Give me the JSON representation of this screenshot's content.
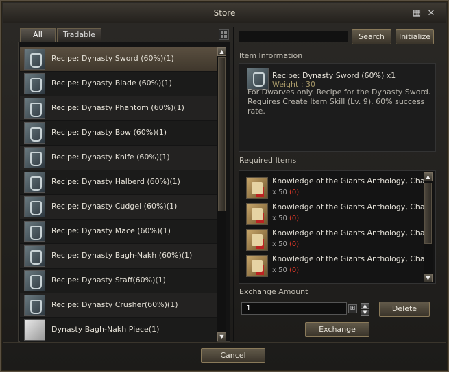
{
  "window": {
    "title": "Store"
  },
  "titlebar_icons": [
    "settings-icon",
    "close-icon"
  ],
  "tabs": [
    {
      "label": "All",
      "active": true
    },
    {
      "label": "Tradable",
      "active": false
    }
  ],
  "item_list": [
    {
      "label": "Recipe: Dynasty Sword (60%)(1)",
      "icon": "recipe-icon",
      "selected": true
    },
    {
      "label": "Recipe: Dynasty Blade (60%)(1)",
      "icon": "recipe-icon"
    },
    {
      "label": "Recipe: Dynasty Phantom (60%)(1)",
      "icon": "recipe-icon"
    },
    {
      "label": "Recipe: Dynasty Bow (60%)(1)",
      "icon": "recipe-icon"
    },
    {
      "label": "Recipe: Dynasty Knife (60%)(1)",
      "icon": "recipe-icon"
    },
    {
      "label": "Recipe: Dynasty Halberd (60%)(1)",
      "icon": "recipe-icon"
    },
    {
      "label": "Recipe: Dynasty Cudgel (60%)(1)",
      "icon": "recipe-icon"
    },
    {
      "label": "Recipe: Dynasty Mace (60%)(1)",
      "icon": "recipe-icon"
    },
    {
      "label": "Recipe: Dynasty Bagh-Nakh (60%)(1)",
      "icon": "recipe-icon"
    },
    {
      "label": "Recipe: Dynasty Staff(60%)(1)",
      "icon": "recipe-icon"
    },
    {
      "label": "Recipe: Dynasty Crusher(60%)(1)",
      "icon": "recipe-icon"
    },
    {
      "label": "Dynasty Bagh-Nakh Piece(1)",
      "icon": "material-box-icon"
    }
  ],
  "search": {
    "value": "",
    "button_label": "Search",
    "initialize_label": "Initialize"
  },
  "item_information": {
    "header": "Item Information",
    "name": "Recipe: Dynasty Sword (60%) x1",
    "weight": "Weight : 30",
    "description_1": "For Dwarves only. Recipe for the Dynasty Sword.",
    "description_2": "Requires Create Item Skill (Lv. 9). 60% success",
    "description_3": "rate."
  },
  "required_items": {
    "header": "Required Items",
    "items": [
      {
        "name": "Knowledge of the Giants Anthology, Chapt",
        "qty": "x 50",
        "owned": "(0)"
      },
      {
        "name": "Knowledge of the Giants Anthology, Chapt",
        "qty": "x 50",
        "owned": "(0)"
      },
      {
        "name": "Knowledge of the Giants Anthology, Chapt",
        "qty": "x 50",
        "owned": "(0)"
      },
      {
        "name": "Knowledge of the Giants Anthology, Chapt",
        "qty": "x 50",
        "owned": "(0)"
      }
    ]
  },
  "exchange": {
    "header": "Exchange Amount",
    "amount": "1",
    "delete_label": "Delete",
    "exchange_label": "Exchange"
  },
  "footer": {
    "cancel_label": "Cancel"
  },
  "colors": {
    "accent_red": "#e23a2a",
    "selected_row": "#5a4f40"
  }
}
